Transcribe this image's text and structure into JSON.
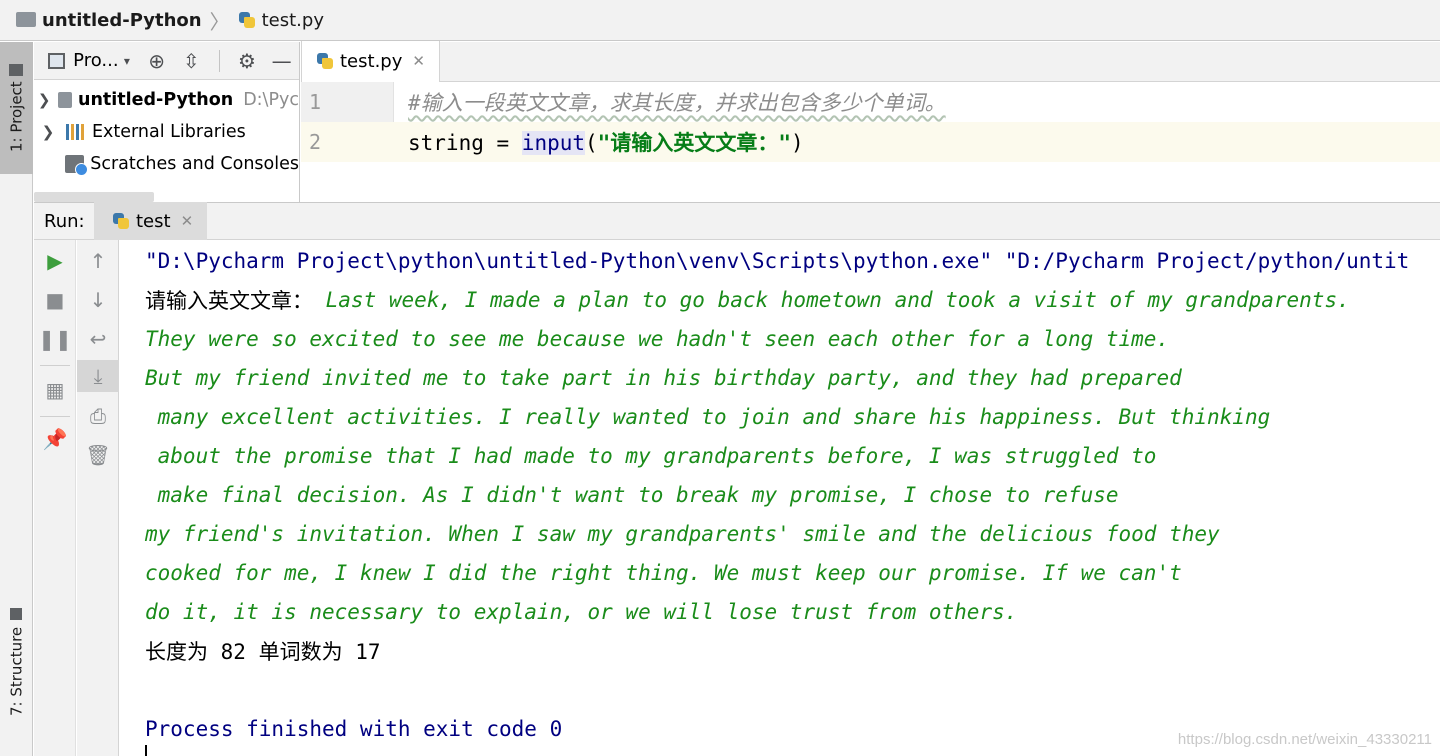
{
  "navbar": {
    "project": "untitled-Python",
    "file": "test.py"
  },
  "toolstrip": {
    "project_tab": "1: Project",
    "structure_tab": "7: Structure"
  },
  "project_panel": {
    "view_label": "Pro...",
    "tree": [
      {
        "label": "untitled-Python",
        "path": "D:\\Pyc"
      },
      {
        "label": "External Libraries"
      },
      {
        "label": "Scratches and Consoles"
      }
    ]
  },
  "editor": {
    "tab": "test.py",
    "lines": [
      {
        "num": "1",
        "comment": "#输入一段英文文章，求其长度，并求出包含多少个单词。"
      },
      {
        "num": "2",
        "var": "string",
        "op": " = ",
        "func": "input",
        "paren_open": "(",
        "str": "\"请输入英文文章：\"",
        "paren_close": ")"
      }
    ]
  },
  "run": {
    "label": "Run:",
    "tab": "test",
    "console": {
      "command": "\"D:\\Pycharm Project\\python\\untitled-Python\\venv\\Scripts\\python.exe\" \"D:/Pycharm Project/python/untit",
      "prompt": "请输入英文文章：",
      "input_lines": [
        " Last week, I made a plan to go back hometown and took a visit of my grandparents.",
        "They were so excited to see me because we hadn't seen each other for a long time.",
        "But my friend invited me to take part in his birthday party, and they had prepared",
        " many excellent activities. I really wanted to join and share his happiness. But thinking",
        " about the promise that I had made to my grandparents before, I was struggled to",
        " make final decision. As I didn't want to break my promise, I chose to refuse",
        "my friend's invitation. When I saw my grandparents' smile and the delicious food they",
        "cooked for me, I knew I did the right thing. We must keep our promise. If we can't",
        "do it, it is necessary to explain, or we will lose trust from others."
      ],
      "result": "长度为 82 单词数为 17",
      "exit": "Process finished with exit code 0"
    }
  },
  "watermark": "https://blog.csdn.net/weixin_43330211"
}
